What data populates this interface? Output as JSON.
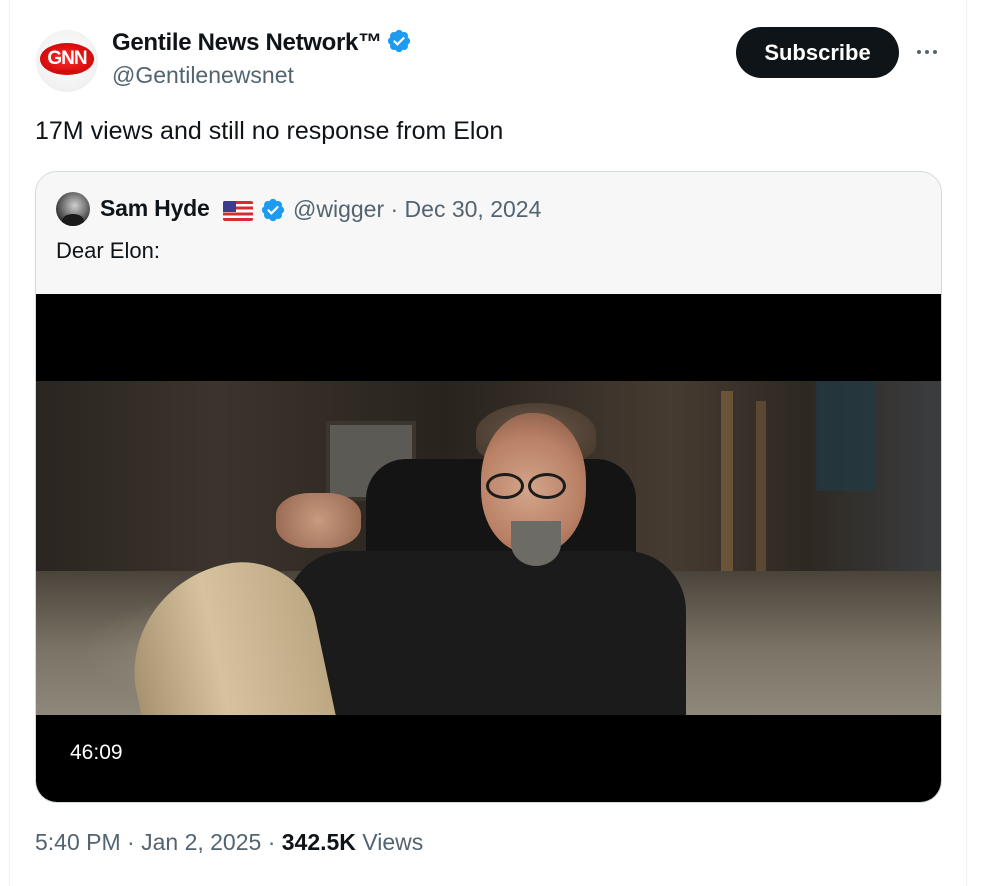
{
  "author": {
    "name": "Gentile News Network™",
    "handle": "@Gentilenewsnet",
    "avatar_logo_text": "GNN",
    "verified_icon": "verified-badge-icon"
  },
  "actions": {
    "subscribe_label": "Subscribe",
    "more_icon": "more-options-icon"
  },
  "tweet": {
    "text": "17M views and still no response from Elon"
  },
  "quoted_tweet": {
    "name": "Sam Hyde",
    "flag_icon": "us-flag-icon",
    "verified_icon": "verified-badge-icon",
    "handle_date": "@wigger · Dec 30, 2024",
    "text": "Dear Elon:",
    "video": {
      "duration": "46:09"
    }
  },
  "meta": {
    "time_date": "5:40 PM · Jan 2, 2025 · ",
    "views_count": "342.5K",
    "views_label": " Views"
  },
  "colors": {
    "text": "#0f1419",
    "secondary": "#536471",
    "verified_blue": "#1d9bf0",
    "button_dark": "#0f1419",
    "border": "#cfd9de"
  }
}
